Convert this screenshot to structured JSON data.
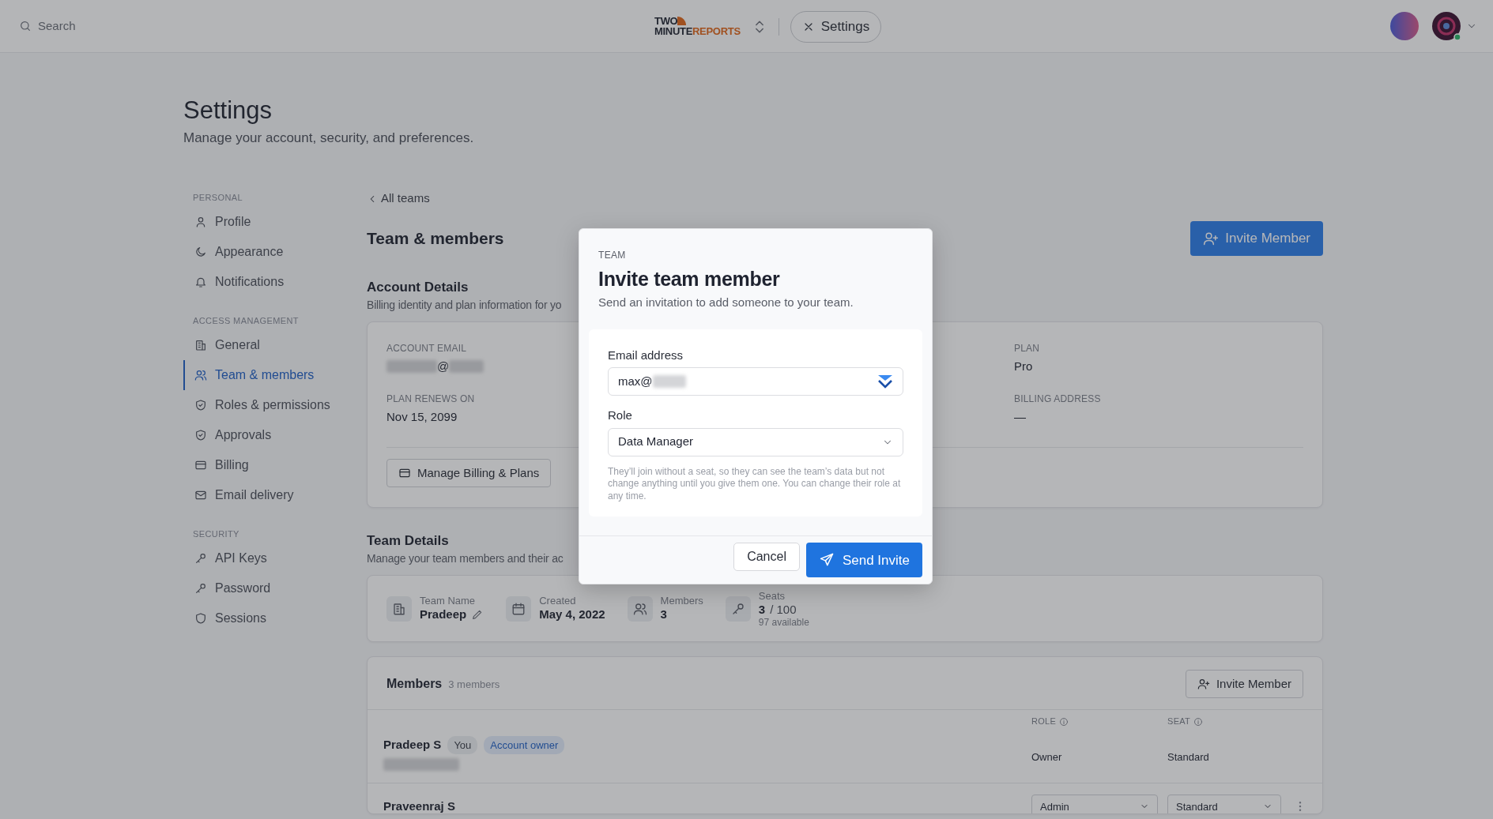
{
  "topbar": {
    "search_placeholder": "Search",
    "logo": {
      "line1": "TWO",
      "line2": "MINUTE",
      "line3": "REPORTS"
    },
    "tab": "Settings"
  },
  "page": {
    "title": "Settings",
    "subtitle": "Manage your account, security, and preferences."
  },
  "sidebar": {
    "sections": [
      {
        "heading": "PERSONAL",
        "items": [
          {
            "label": "Profile",
            "selected": false
          },
          {
            "label": "Appearance",
            "selected": false
          },
          {
            "label": "Notifications",
            "selected": false
          }
        ]
      },
      {
        "heading": "ACCESS MANAGEMENT",
        "items": [
          {
            "label": "General",
            "selected": false
          },
          {
            "label": "Team & members",
            "selected": true
          },
          {
            "label": "Roles & permissions",
            "selected": false
          },
          {
            "label": "Approvals",
            "selected": false
          },
          {
            "label": "Billing",
            "selected": false
          },
          {
            "label": "Email delivery",
            "selected": false
          }
        ]
      },
      {
        "heading": "SECURITY",
        "items": [
          {
            "label": "API Keys",
            "selected": false
          },
          {
            "label": "Password",
            "selected": false
          },
          {
            "label": "Sessions",
            "selected": false
          }
        ]
      }
    ]
  },
  "back_link": "All teams",
  "section_title": "Team & members",
  "invite_button": "Invite Member",
  "account_details": {
    "title": "Account Details",
    "subtitle": "Billing identity and plan information for yo",
    "fields": [
      {
        "label": "ACCOUNT EMAIL",
        "value": "@",
        "blurred": true
      },
      {
        "label": "PLAN",
        "value": "Pro",
        "blurred": false
      },
      {
        "label": "PLAN RENEWS ON",
        "value": "Nov 15, 2099",
        "blurred": false
      },
      {
        "label": "BILLING ADDRESS",
        "value": "—",
        "blurred": false
      }
    ],
    "button": "Manage Billing & Plans"
  },
  "team_details": {
    "title": "Team Details",
    "subtitle": "Manage your team members and their ac",
    "stats": [
      {
        "label": "Team Name",
        "value": "Pradeep",
        "editable": true
      },
      {
        "label": "Created",
        "value": "May 4, 2022",
        "editable": false
      },
      {
        "label": "Members",
        "value": "3",
        "editable": false
      },
      {
        "label": "Seats",
        "value": "3",
        "total": "/ 100",
        "note": "97 available",
        "editable": false
      }
    ]
  },
  "members": {
    "title": "Members",
    "count": "3 members",
    "invite_button": "Invite Member",
    "columns": [
      "ROLE",
      "SEAT"
    ],
    "rows": [
      {
        "name": "Pradeep S",
        "badges": [
          "You",
          "Account owner"
        ],
        "email_blurred": true,
        "kind": "text",
        "role": "Owner",
        "seat": "Standard"
      },
      {
        "name": "Praveenraj S",
        "badges": [],
        "email_blurred": false,
        "kind": "select",
        "role": "Admin",
        "seat": "Standard"
      }
    ]
  },
  "modal": {
    "eyebrow": "TEAM",
    "title": "Invite team member",
    "subtitle": "Send an invitation to add someone to your team.",
    "email_label": "Email address",
    "email_value": "max@",
    "email_blurred": true,
    "role_label": "Role",
    "role_value": "Data Manager",
    "help": "They’ll join without a seat, so they can see the team’s data but not change anything until you give them one. You can change their role at any time.",
    "cancel": "Cancel",
    "submit": "Send Invite"
  }
}
